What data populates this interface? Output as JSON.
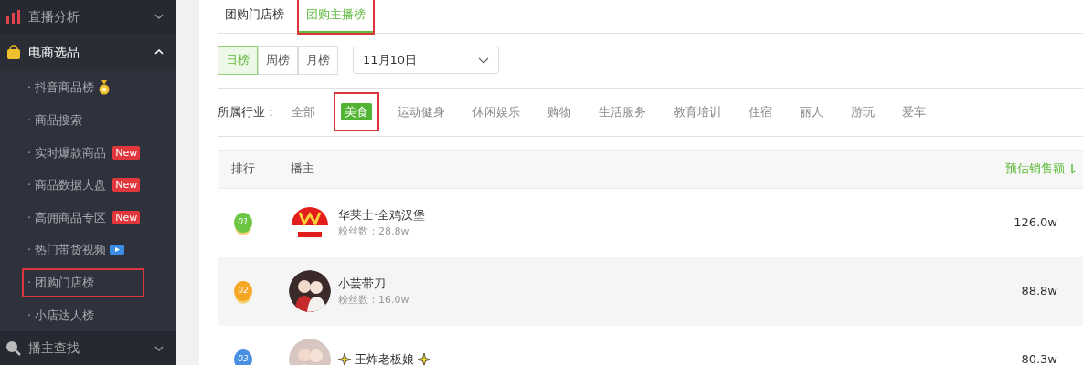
{
  "sidebar": {
    "sections": [
      {
        "label": "直播分析",
        "expanded": false
      },
      {
        "label": "电商选品",
        "expanded": true,
        "children": [
          {
            "label": "· 抖音商品榜",
            "kind": "medal",
            "selected": false,
            "highlighted": false
          },
          {
            "label": "· 商品搜索",
            "kind": "plain",
            "selected": false,
            "highlighted": false
          },
          {
            "label": "· 实时爆款商品",
            "kind": "new",
            "badge": "New",
            "selected": false,
            "highlighted": false
          },
          {
            "label": "· 商品数据大盘",
            "kind": "new",
            "badge": "New",
            "selected": false,
            "highlighted": false
          },
          {
            "label": "· 高佣商品专区",
            "kind": "new",
            "badge": "New",
            "selected": false,
            "highlighted": false
          },
          {
            "label": "· 热门带货视频",
            "kind": "video",
            "selected": false,
            "highlighted": false
          },
          {
            "label": "· 团购门店榜",
            "kind": "plain",
            "selected": true,
            "highlighted": true
          },
          {
            "label": "· 小店达人榜",
            "kind": "plain",
            "selected": false,
            "highlighted": false
          }
        ]
      },
      {
        "label": "播主查找",
        "expanded": false
      }
    ]
  },
  "tabs": [
    {
      "label": "团购门店榜",
      "selected": false,
      "highlighted": false
    },
    {
      "label": "团购主播榜",
      "selected": true,
      "highlighted": true
    }
  ],
  "periods": [
    {
      "label": "日榜",
      "selected": true
    },
    {
      "label": "周榜",
      "selected": false
    },
    {
      "label": "月榜",
      "selected": false
    }
  ],
  "date": {
    "value": "11月10日"
  },
  "industry": {
    "label": "所属行业：",
    "options": [
      {
        "label": "全部",
        "selected": false,
        "highlighted": false
      },
      {
        "label": "美食",
        "selected": true,
        "highlighted": true
      },
      {
        "label": "运动健身",
        "selected": false,
        "highlighted": false
      },
      {
        "label": "休闲娱乐",
        "selected": false,
        "highlighted": false
      },
      {
        "label": "购物",
        "selected": false,
        "highlighted": false
      },
      {
        "label": "生活服务",
        "selected": false,
        "highlighted": false
      },
      {
        "label": "教育培训",
        "selected": false,
        "highlighted": false
      },
      {
        "label": "住宿",
        "selected": false,
        "highlighted": false
      },
      {
        "label": "丽人",
        "selected": false,
        "highlighted": false
      },
      {
        "label": "游玩",
        "selected": false,
        "highlighted": false
      },
      {
        "label": "爱车",
        "selected": false,
        "highlighted": false
      }
    ]
  },
  "table": {
    "columns": [
      {
        "label": "排行",
        "sorted": false
      },
      {
        "label": "播主",
        "sorted": false
      },
      {
        "label": "预估销售额",
        "sorted": true
      }
    ],
    "rows": [
      {
        "rank": "01",
        "color": "#6cc644",
        "name": "华莱士·全鸡汉堡",
        "sparkles": false,
        "fans": "粉丝数：28.8w",
        "sales": "126.0w"
      },
      {
        "rank": "02",
        "color": "#f5a623",
        "name": "小芸带刀",
        "sparkles": false,
        "fans": "粉丝数：16.0w",
        "sales": "88.8w"
      },
      {
        "rank": "03",
        "color": "#4a90e2",
        "name": "王炸老板娘",
        "sparkles": true,
        "sales": "80.3w"
      }
    ]
  }
}
